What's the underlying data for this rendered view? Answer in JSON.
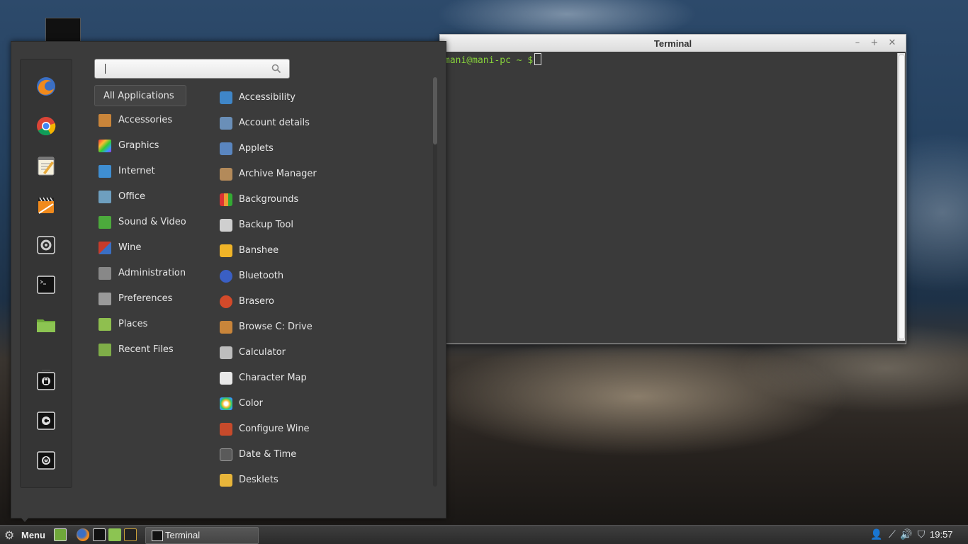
{
  "terminal": {
    "title": "Terminal",
    "prompt": "mani@mani-pc ~ $",
    "minimize_glyph": "–",
    "maximize_glyph": "+",
    "close_glyph": "✕"
  },
  "menu": {
    "search_placeholder": "",
    "favorites": [
      "firefox-icon",
      "chrome-icon",
      "text-editor-icon",
      "media-player-icon",
      "system-settings-icon",
      "terminal-icon",
      "files-icon",
      "lock-screen-icon",
      "logout-icon",
      "shutdown-icon"
    ],
    "categories": [
      {
        "label": "All Applications",
        "icon": "all-apps",
        "selected": true
      },
      {
        "label": "Accessories",
        "icon": "accessories-icon",
        "color": "#c9853a"
      },
      {
        "label": "Graphics",
        "icon": "graphics-icon",
        "color": "#e34d7a"
      },
      {
        "label": "Internet",
        "icon": "internet-icon",
        "color": "#3f8ed1"
      },
      {
        "label": "Office",
        "icon": "office-icon",
        "color": "#6e9fbf"
      },
      {
        "label": "Sound & Video",
        "icon": "sound-video-icon",
        "color": "#4caa3c"
      },
      {
        "label": "Wine",
        "icon": "wine-icon",
        "color": "#c73b2b"
      },
      {
        "label": "Administration",
        "icon": "administration-icon",
        "color": "#888888"
      },
      {
        "label": "Preferences",
        "icon": "preferences-icon",
        "color": "#9a9a9a"
      },
      {
        "label": "Places",
        "icon": "places-icon",
        "color": "#8fbf4f"
      },
      {
        "label": "Recent Files",
        "icon": "recent-files-icon",
        "color": "#7fae48"
      }
    ],
    "apps": [
      {
        "label": "Accessibility",
        "icon": "accessibility-icon",
        "color": "#3f86c8"
      },
      {
        "label": "Account details",
        "icon": "account-details-icon",
        "color": "#6a8fb8"
      },
      {
        "label": "Applets",
        "icon": "applets-icon",
        "color": "#5a86c0"
      },
      {
        "label": "Archive Manager",
        "icon": "archive-manager-icon",
        "color": "#b38a5a"
      },
      {
        "label": "Backgrounds",
        "icon": "backgrounds-icon",
        "color": "#d26a2a"
      },
      {
        "label": "Backup Tool",
        "icon": "backup-tool-icon",
        "color": "#cfcfcf"
      },
      {
        "label": "Banshee",
        "icon": "banshee-icon",
        "color": "#f0b428"
      },
      {
        "label": "Bluetooth",
        "icon": "bluetooth-icon",
        "color": "#3a5fc4"
      },
      {
        "label": "Brasero",
        "icon": "brasero-icon",
        "color": "#d34a2a"
      },
      {
        "label": "Browse C: Drive",
        "icon": "browse-c-drive-icon",
        "color": "#c9853a"
      },
      {
        "label": "Calculator",
        "icon": "calculator-icon",
        "color": "#bdbdbd"
      },
      {
        "label": "Character Map",
        "icon": "character-map-icon",
        "color": "#e8e8e8"
      },
      {
        "label": "Color",
        "icon": "color-icon",
        "color": "#e6e6e6"
      },
      {
        "label": "Configure Wine",
        "icon": "configure-wine-icon",
        "color": "#c74a2b"
      },
      {
        "label": "Date & Time",
        "icon": "date-time-icon",
        "color": "#5a5a5a"
      },
      {
        "label": "Desklets",
        "icon": "desklets-icon",
        "color": "#e8b53a"
      }
    ]
  },
  "taskbar": {
    "menu_label": "Menu",
    "task_terminal_label": "Terminal",
    "clock": "19:57",
    "tray_icons": [
      "user-icon",
      "network-icon",
      "volume-icon",
      "update-shield-icon"
    ],
    "launchers": [
      "show-desktop-icon",
      "firefox-icon",
      "terminal-icon",
      "files-icon",
      "system-monitor-icon"
    ]
  }
}
